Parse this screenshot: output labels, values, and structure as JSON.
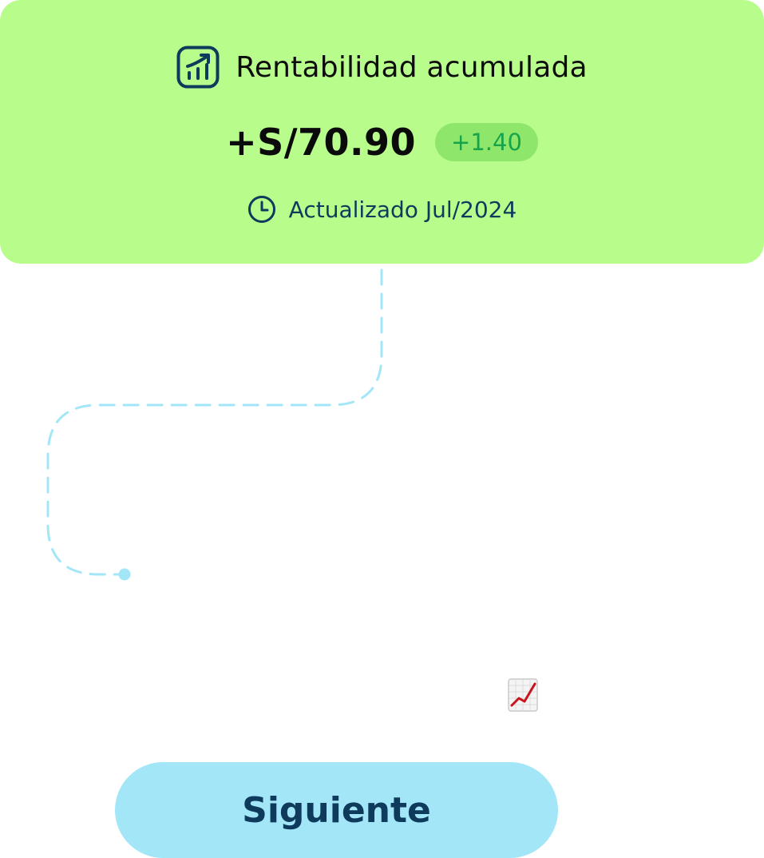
{
  "summary_card": {
    "title": "Rentabilidad acumulada",
    "title_icon": "chart-growth-icon",
    "amount": "+S/70.90",
    "delta": "+1.40",
    "updated_icon": "clock-icon",
    "updated_text": "Actualizado Jul/2024"
  },
  "decoration": {
    "emoji": "chart-increasing-emoji"
  },
  "footer": {
    "next_label": "Siguiente"
  },
  "colors": {
    "card_background": "#b8fd8c",
    "badge_background": "#8ee76a",
    "badge_text": "#16a34a",
    "navy": "#0e3a5c",
    "dashed_path": "#a3e6f8",
    "button_background": "#a3e6f8"
  }
}
